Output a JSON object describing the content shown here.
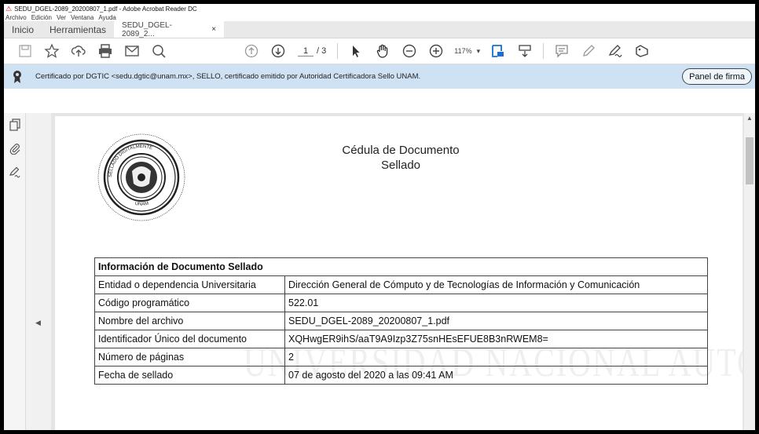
{
  "window": {
    "title": "SEDU_DGEL-2089_20200807_1.pdf - Adobe Acrobat Reader DC",
    "menu": [
      "Archivo",
      "Edición",
      "Ver",
      "Ventana",
      "Ayuda"
    ]
  },
  "tabs": {
    "home": "Inicio",
    "tools": "Herramientas",
    "document": "SEDU_DGEL-2089_2...",
    "close": "×"
  },
  "toolbar": {
    "page_current": "1",
    "page_total": "/ 3",
    "zoom": "117%"
  },
  "certbar": {
    "message": "Certificado por DGTIC <sedu.dgtic@unam.mx>, SELLO, certificado emitido por Autoridad Certificadora Sello UNAM.",
    "panel_button": "Panel de firma"
  },
  "document": {
    "title_line1": "Cédula de Documento",
    "title_line2": "Sellado",
    "seal_text_top": "SELLADO DIGITALMENTE",
    "seal_text_bottom": "UNAM",
    "watermark": "UNIVERSIDAD NACIONAL AUTONOMA D MEXICO",
    "table_header": "Información de Documento Sellado",
    "rows": [
      {
        "label": "Entidad o dependencia Universitaria",
        "value": "Dirección General de Cómputo y de Tecnologías de Información y Comunicación"
      },
      {
        "label": "Código programático",
        "value": "522.01"
      },
      {
        "label": "Nombre del archivo",
        "value": "SEDU_DGEL-2089_20200807_1.pdf"
      },
      {
        "label": "Identificador Único del documento",
        "value": "XQHwgER9ihS/aaT9A9Izp3Z75snHEsEFUE8B3nRWEM8="
      },
      {
        "label": "Número de páginas",
        "value": "2"
      },
      {
        "label": "Fecha de sellado",
        "value": "07 de agosto del 2020 a las 09:41 AM"
      }
    ]
  },
  "colors": {
    "certbar_bg": "#cfe2f3",
    "tab_active_bg": "#ffffff"
  }
}
